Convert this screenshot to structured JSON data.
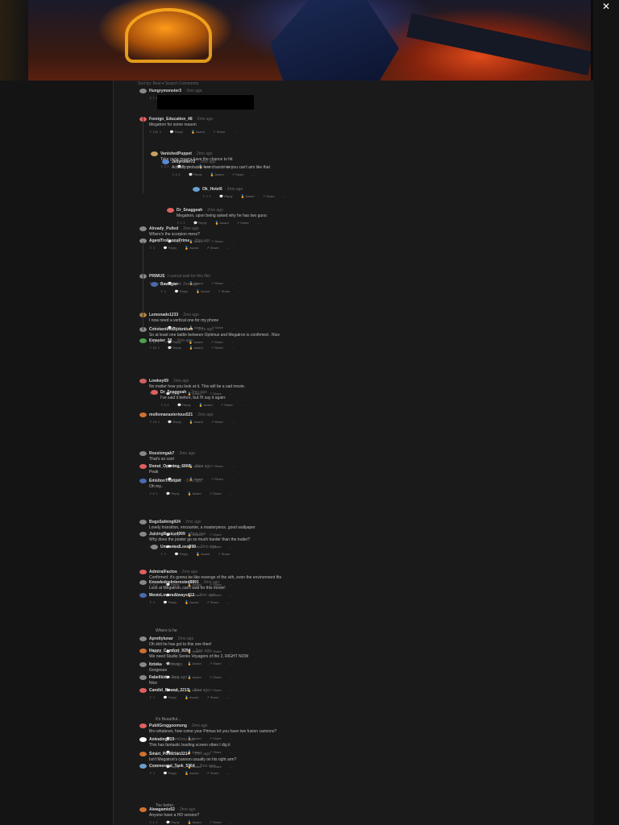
{
  "close_label": "✕",
  "sortbar": "Sort by: Best ▾   Search Comments",
  "actions": {
    "reply": "Reply",
    "award": "Award",
    "share": "Share",
    "more": "…"
  },
  "comments": [
    {
      "user": "Hungrymonster3",
      "time": "· 2mo ago",
      "text": "",
      "votes": "7",
      "avatar": "#888"
    },
    {
      "user": "Foreign_Education_48",
      "time": "· 2mo ago",
      "text": "Megatron for some reason",
      "votes": "141",
      "avatar": "#e06060"
    },
    {
      "user": "VanishedPuppet",
      "time": "· 2mo ago",
      "text": "Take guns means have the chance to hit",
      "votes": "3",
      "avatar": "#caa060"
    },
    {
      "user": "Jellyroller72",
      "time": "· 2mo ago",
      "text": "Actually probably less chance as you can't aim like that",
      "votes": "4",
      "avatar": "#5a8ad0"
    },
    {
      "user": "Ok_Hotel6",
      "time": "· 2mo ago",
      "text": "",
      "votes": "2",
      "avatar": "#6aa0d0"
    },
    {
      "user": "Dr_Snaggeah",
      "time": "· 2mo ago",
      "text": "Megatron, upon being asked why he has two guns:",
      "votes": "1",
      "avatar": "#e06060"
    },
    {
      "user": "Already_Pulled",
      "time": "· 2mo ago",
      "text": "Where's the scorpion mess?",
      "votes": "17",
      "avatar": "#888"
    },
    {
      "user": "AgentTrollsonsPrime",
      "time": "· 2mo ago",
      "text": "",
      "votes": "",
      "avatar": "#888"
    },
    {
      "user": "PRIMUS",
      "time": "I cannot wait for this film",
      "votes": "24",
      "avatar": "#888"
    },
    {
      "user": "Bawagan",
      "time": "· 2mo ago",
      "text": "",
      "votes": "",
      "avatar": "#4a6ab0"
    },
    {
      "user": "Lemonade1233",
      "time": "· 2mo ago",
      "text": "I now need a vertical one for my phone",
      "votes": "32",
      "avatar": "#b08040"
    },
    {
      "user": "ConstantinoByzantium",
      "time": "· 2mo ago",
      "text": "So at least one battle between Optimus and Megatron is confirmed . Nice",
      "votes": "11",
      "avatar": "#888"
    },
    {
      "user": "Kmaster_30",
      "time": "· 2mo ago",
      "text": "",
      "votes": "20",
      "avatar": "#50a050"
    },
    {
      "user": "Lowkey69",
      "time": "· 2mo ago",
      "text": "No matter how you look at it. This will be a sad movie.",
      "votes": "3",
      "avatar": "#d06060"
    },
    {
      "user": "Dr_Snaggeah",
      "time": "· 2mo ago",
      "text": "I've said it before, but I'll say it again:",
      "votes": "3",
      "avatar": "#e06060"
    },
    {
      "user": "mollomanasterious521",
      "time": "· 2mo ago",
      "text": "",
      "votes": "19",
      "avatar": "#d07030"
    },
    {
      "user": "Rossiongab7",
      "time": "· 2mo ago",
      "text": "That's so cool",
      "votes": "17",
      "avatar": "#888"
    },
    {
      "user": "Donut_Opening_6868",
      "time": "· 2mo ago",
      "text": "Peak",
      "votes": "13",
      "avatar": "#e06060"
    },
    {
      "user": "EmotionTrumpet",
      "time": "· 2mo ago",
      "text": "Oh my..",
      "votes": "6",
      "avatar": "#4a6ab0"
    },
    {
      "user": "BugsSafeing924",
      "time": "· 2mo ago",
      "text": "Lovely transition, encounter, a masterpiece, good wallpaper",
      "votes": "3",
      "avatar": "#888"
    },
    {
      "user": "JuicingBasics4999",
      "time": "· 2mo ago",
      "text": "Why does the poster go so much harder than the trailer?",
      "votes": "3",
      "avatar": "#888"
    },
    {
      "user": "UnwantedLoss999",
      "time": "· 2mo ago",
      "text": "",
      "votes": "",
      "avatar": "#888"
    },
    {
      "user": "AdmiralFactos",
      "time": "· 2mo ago",
      "text": "Confirmed: it's gonna be like revenge of the sith, even the environment fits",
      "votes": "4",
      "avatar": "#e06060"
    },
    {
      "user": "KnowledgeInterested8891",
      "time": "· 2mo ago",
      "text": "Lock at Megatron, can't wait for this movie!",
      "votes": "1",
      "avatar": "#888"
    },
    {
      "user": "MovieLoversAlways412",
      "time": "· 2mo ago",
      "text": "",
      "votes": "",
      "avatar": "#4a6ab0"
    },
    {
      "user": "Aprettylunar",
      "time": "· 2mo ago",
      "text": "Oh shit he has got to this one then!",
      "votes": "1",
      "avatar": "#888"
    },
    {
      "user": "Happy_Comfort_9294",
      "time": "· 2mo ago",
      "text": "We need Studio Series Voyagers of the 2, RIGHT NOW",
      "votes": "1",
      "avatar": "#d07030"
    },
    {
      "user": "Itztoka",
      "time": "· 2mo ago",
      "text": "Gorgeous",
      "votes": "1",
      "avatar": "#888"
    },
    {
      "user": "Fabelikid",
      "time": "· 2mo ago",
      "text": "Nice",
      "votes": "1",
      "avatar": "#888"
    },
    {
      "user": "Candid_Round_2213",
      "time": "· 2mo ago",
      "text": "",
      "votes": "",
      "avatar": "#e06060"
    },
    {
      "user": "PubliGroggoomong",
      "time": "· 2mo ago",
      "text": "Bro whatever, how come your Primus let you have two fusion cannons?",
      "votes": "1",
      "avatar": "#e06060"
    },
    {
      "user": "Anivating213",
      "time": "· 2mo ago",
      "text": "This has fantastic leading screen vibes I dig it",
      "votes": "1",
      "avatar": "#fff"
    },
    {
      "user": "Smart_Politician3214",
      "time": "· 2mo ago",
      "text": "Isn't Megatron's cannon usually on his right arm?",
      "votes": "1",
      "avatar": "#d07030"
    },
    {
      "user": "Commercial_Tank_5364",
      "time": "· 2mo ago",
      "text": "",
      "votes": "",
      "avatar": "#6aa0d0"
    },
    {
      "user": "Aiwagamio52",
      "time": "· 2mo ago",
      "text": "Anyone have a HD version?",
      "votes": "1",
      "avatar": "#d07030"
    }
  ],
  "extra_text": [
    "Where is he",
    "It's Beautiful...",
    "Too better."
  ]
}
